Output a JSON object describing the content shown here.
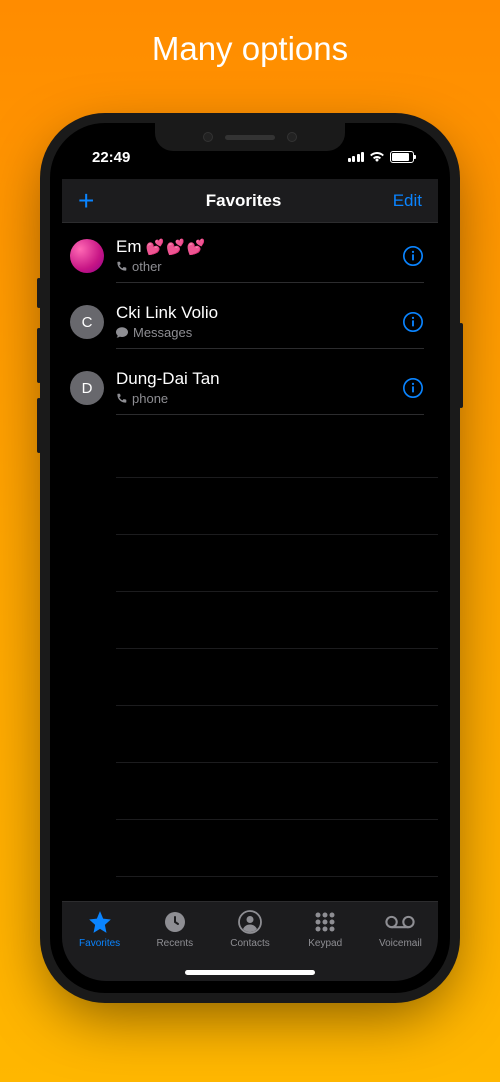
{
  "page": {
    "title": "Many options"
  },
  "statusBar": {
    "time": "22:49"
  },
  "navBar": {
    "title": "Favorites",
    "edit": "Edit"
  },
  "favorites": [
    {
      "name": "Em",
      "hearts": "💕💕💕",
      "subIcon": "phone",
      "subText": "other",
      "avatarType": "img",
      "avatarInitial": ""
    },
    {
      "name": "Cki Link Volio",
      "hearts": "",
      "subIcon": "message",
      "subText": "Messages",
      "avatarType": "gray",
      "avatarInitial": "C"
    },
    {
      "name": "Dung-Dai Tan",
      "hearts": "",
      "subIcon": "phone",
      "subText": "phone",
      "avatarType": "gray",
      "avatarInitial": "D"
    }
  ],
  "tabs": [
    {
      "label": "Favorites",
      "icon": "star",
      "active": true
    },
    {
      "label": "Recents",
      "icon": "clock",
      "active": false
    },
    {
      "label": "Contacts",
      "icon": "contact",
      "active": false
    },
    {
      "label": "Keypad",
      "icon": "keypad",
      "active": false
    },
    {
      "label": "Voicemail",
      "icon": "voicemail",
      "active": false
    }
  ]
}
